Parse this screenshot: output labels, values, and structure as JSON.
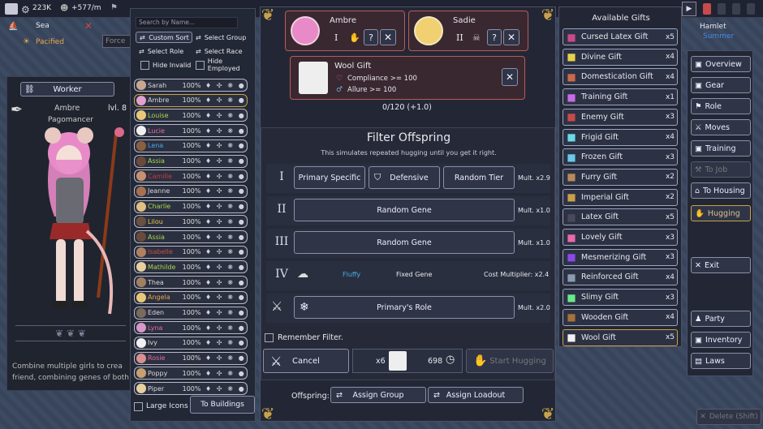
{
  "topbar": {
    "gold_value": "223K",
    "income_value": "+577/m",
    "location": "Sea",
    "status": "Pacified",
    "force_placeholder": "Force",
    "right_location": "Hamlet",
    "right_sub": "Summer"
  },
  "character": {
    "role_button": "Worker",
    "name": "Ambre",
    "level": "lvl. 8",
    "title": "Pagomancer",
    "description": "Combine multiple girls to crea friend, combining genes of both"
  },
  "roster": {
    "search_placeholder": "Search by Name...",
    "custom_sort": "Custom Sort",
    "select_group": "Select Group",
    "select_role": "Select Role",
    "select_race": "Select Race",
    "hide_invalid": "Hide Invalid",
    "hide_employed": "Hide Employed",
    "large_icons": "Large Icons",
    "to_buildings": "To Buildings",
    "rows": [
      {
        "name": "Sarah",
        "pct": "100%",
        "color": "#d8d8d8",
        "av": "#c8a890"
      },
      {
        "name": "Ambre",
        "pct": "100%",
        "color": "#d8d8d8",
        "av": "#e0a0d0"
      },
      {
        "name": "Louise",
        "pct": "100%",
        "color": "#a8d84a",
        "av": "#e8c878"
      },
      {
        "name": "Lucie",
        "pct": "100%",
        "color": "#e86aa8",
        "av": "#f0f0f0"
      },
      {
        "name": "Lena",
        "pct": "100%",
        "color": "#4aa8e8",
        "av": "#8a6040"
      },
      {
        "name": "Assia",
        "pct": "100%",
        "color": "#a8d84a",
        "av": "#6a4a3a"
      },
      {
        "name": "Camille",
        "pct": "100%",
        "color": "#c83a3a",
        "av": "#c89070"
      },
      {
        "name": "Jeanne",
        "pct": "100%",
        "color": "#d8d8d8",
        "av": "#a87050"
      },
      {
        "name": "Charlie",
        "pct": "100%",
        "color": "#a8d84a",
        "av": "#e0c080"
      },
      {
        "name": "Lilou",
        "pct": "100%",
        "color": "#e8c84a",
        "av": "#6a5040"
      },
      {
        "name": "Assia",
        "pct": "100%",
        "color": "#a8d84a",
        "av": "#6a4a3a"
      },
      {
        "name": "Isabelle",
        "pct": "100%",
        "color": "#c8503a",
        "av": "#b08060"
      },
      {
        "name": "Mathilde",
        "pct": "100%",
        "color": "#a8d84a",
        "av": "#e8d0a0"
      },
      {
        "name": "Thea",
        "pct": "100%",
        "color": "#d8d8d8",
        "av": "#a08060"
      },
      {
        "name": "Angela",
        "pct": "100%",
        "color": "#e8a84a",
        "av": "#e8c878"
      },
      {
        "name": "Eden",
        "pct": "100%",
        "color": "#d8d8d8",
        "av": "#7a6a5a"
      },
      {
        "name": "Lyna",
        "pct": "100%",
        "color": "#e86aa8",
        "av": "#d898c8"
      },
      {
        "name": "Ivy",
        "pct": "100%",
        "color": "#d8d8d8",
        "av": "#f0f0f0"
      },
      {
        "name": "Rosie",
        "pct": "100%",
        "color": "#e86aa8",
        "av": "#d89090"
      },
      {
        "name": "Poppy",
        "pct": "100%",
        "color": "#d8d8d8",
        "av": "#c8a070"
      },
      {
        "name": "Piper",
        "pct": "100%",
        "color": "#d8d8d8",
        "av": "#e8d0a0"
      }
    ]
  },
  "parents": {
    "left_name": "Ambre",
    "left_tier": "I",
    "right_name": "Sadie",
    "right_tier": "II",
    "help": "?",
    "close": "✕"
  },
  "gift": {
    "name": "Wool Gift",
    "req1": "Compliance >= 100",
    "req2": "Allure >= 100",
    "progress": "0/120 (+1.0)"
  },
  "filter": {
    "title": "Filter Offspring",
    "subtitle": "This simulates repeated hugging until you get it right.",
    "row1": {
      "roman": "I",
      "b1": "Primary Specific",
      "b2": "Defensive",
      "b3": "Random Tier",
      "mult": "Mult. x2.9"
    },
    "row2": {
      "roman": "II",
      "b1": "Random Gene",
      "mult": "Mult. x1.0"
    },
    "row3": {
      "roman": "III",
      "b1": "Random Gene",
      "mult": "Mult. x1.0"
    },
    "row4": {
      "roman": "IV",
      "gene": "Fluffy",
      "fixed": "Fixed Gene",
      "cost": "Cost Multiplier: x2.4"
    },
    "row5": {
      "b1": "Primary's Role",
      "mult": "Mult. x2.0"
    },
    "remember": "Remember Filter.",
    "cancel": "Cancel",
    "gift_count": "x6",
    "time_value": "698",
    "start": "Start Hugging",
    "offspring_label": "Offspring:",
    "assign_group": "Assign Group",
    "assign_loadout": "Assign Loadout"
  },
  "gifts": {
    "title": "Available Gifts",
    "items": [
      {
        "name": "Cursed Latex Gift",
        "qty": "x5",
        "color": "#c84a8a"
      },
      {
        "name": "Divine Gift",
        "qty": "x4",
        "color": "#e8d04a"
      },
      {
        "name": "Domestication Gift",
        "qty": "x4",
        "color": "#c86a4a"
      },
      {
        "name": "Training Gift",
        "qty": "x1",
        "color": "#c86ae8"
      },
      {
        "name": "Enemy Gift",
        "qty": "x3",
        "color": "#c84a4a"
      },
      {
        "name": "Frigid Gift",
        "qty": "x4",
        "color": "#6ad8e8"
      },
      {
        "name": "Frozen Gift",
        "qty": "x3",
        "color": "#6ac8e8"
      },
      {
        "name": "Furry Gift",
        "qty": "x2",
        "color": "#b88a5a"
      },
      {
        "name": "Imperial Gift",
        "qty": "x2",
        "color": "#c8a04a"
      },
      {
        "name": "Latex Gift",
        "qty": "x5",
        "color": "#4a4a5a"
      },
      {
        "name": "Lovely Gift",
        "qty": "x3",
        "color": "#e86aa8"
      },
      {
        "name": "Mesmerizing Gift",
        "qty": "x3",
        "color": "#8a4ae8"
      },
      {
        "name": "Reinforced Gift",
        "qty": "x4",
        "color": "#8a9ab0"
      },
      {
        "name": "Slimy Gift",
        "qty": "x3",
        "color": "#6ae88a"
      },
      {
        "name": "Wooden Gift",
        "qty": "x4",
        "color": "#a8703a"
      },
      {
        "name": "Wool Gift",
        "qty": "x5",
        "color": "#f0f0f0"
      }
    ]
  },
  "nav": {
    "overview": "Overview",
    "gear": "Gear",
    "role": "Role",
    "moves": "Moves",
    "training": "Training",
    "to_job": "To Job",
    "to_housing": "To Housing",
    "hugging": "Hugging",
    "exit": "Exit",
    "party": "Party",
    "inventory": "Inventory",
    "laws": "Laws",
    "delete": "Delete (Shift)"
  }
}
